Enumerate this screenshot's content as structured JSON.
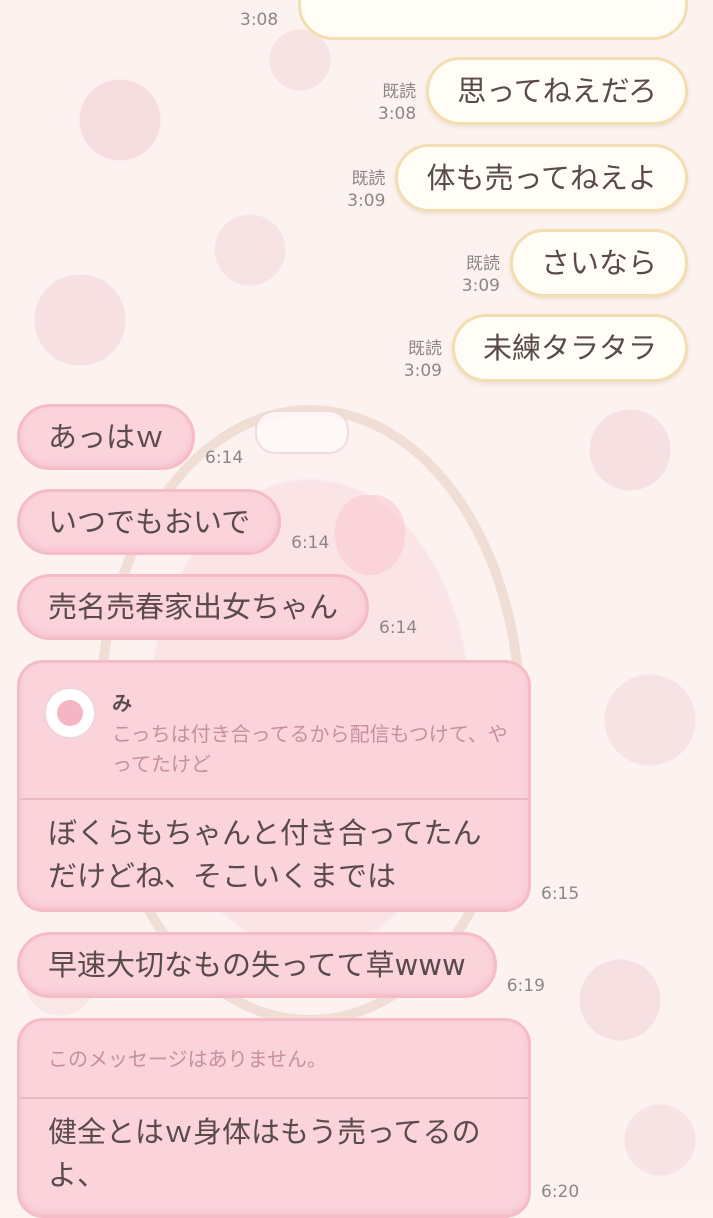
{
  "top": {
    "time": "3:08"
  },
  "outgoing": [
    {
      "status": "既読",
      "time": "3:08",
      "text": "思ってねえだろ"
    },
    {
      "status": "既読",
      "time": "3:09",
      "text": "体も売ってねえよ"
    },
    {
      "status": "既読",
      "time": "3:09",
      "text": "さいなら"
    },
    {
      "status": "既読",
      "time": "3:09",
      "text": "未練タラタラ"
    }
  ],
  "incoming": [
    {
      "text": "あっはｗ",
      "time": "6:14"
    },
    {
      "text": "いつでもおいで",
      "time": "6:14"
    },
    {
      "text": "売名売春家出女ちゃん",
      "time": "6:14"
    },
    {
      "text": "早速大切なもの失ってて草www",
      "time": "6:19"
    }
  ],
  "reply_card": {
    "quoted_name": "み",
    "quoted_text": "こっちは付き合ってるから配信もつけて、やってたけど",
    "line1": "ぼくらもちゃんと付き合ってたん",
    "line2": "だけどね、そこいくまでは",
    "time": "6:15"
  },
  "deleted_card": {
    "notice": "このメッセージはありません。",
    "line1": "健全とはｗ身体はもう売ってるの",
    "line2": "よ、",
    "time": "6:20"
  },
  "colors": {
    "incoming_bubble": "#fbd3db",
    "outgoing_bubble": "#fffdf5",
    "outgoing_border": "#f3deb1"
  }
}
